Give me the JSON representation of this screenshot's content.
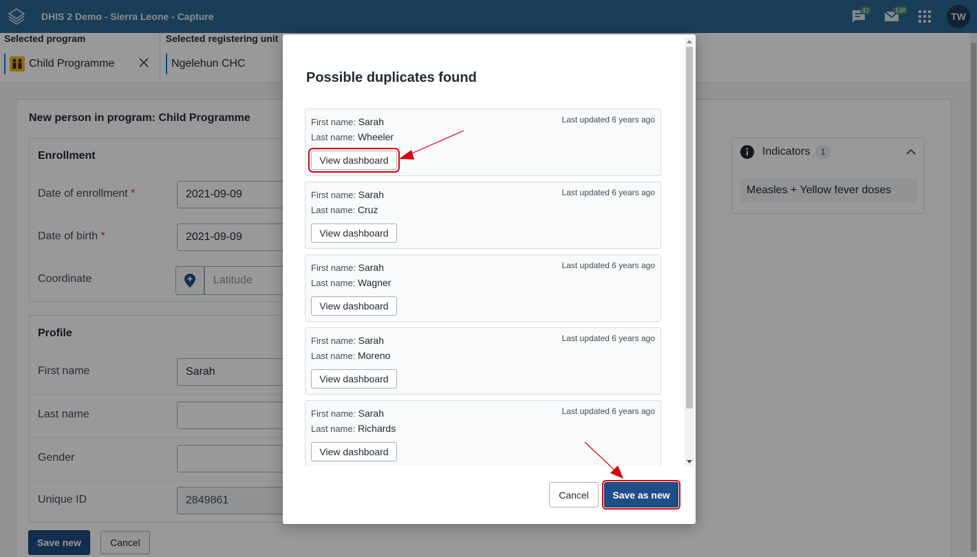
{
  "header": {
    "app_title": "DHIS 2 Demo - Sierra Leone - Capture",
    "messages_count": "42",
    "interpretations_count": "138",
    "user_initials": "TW"
  },
  "topbar": {
    "program_label": "Selected program",
    "program_value": "Child Programme",
    "org_unit_label": "Selected registering unit",
    "org_unit_value": "Ngelehun CHC"
  },
  "form": {
    "title": "New person in program: Child Programme",
    "enrollment": {
      "title": "Enrollment",
      "date_of_enrollment_label": "Date of enrollment",
      "date_of_enrollment_value": "2021-09-09",
      "date_of_birth_label": "Date of birth",
      "date_of_birth_value": "2021-09-09",
      "coordinate_label": "Coordinate",
      "latitude_placeholder": "Latitude",
      "required_marker": "*"
    },
    "profile": {
      "title": "Profile",
      "first_name_label": "First name",
      "first_name_value": "Sarah",
      "last_name_label": "Last name",
      "last_name_value": "",
      "gender_label": "Gender",
      "gender_value": "",
      "unique_id_label": "Unique ID",
      "unique_id_value": "2849861"
    },
    "save_new_label": "Save new",
    "cancel_label": "Cancel"
  },
  "indicators": {
    "title": "Indicators",
    "count": "1",
    "items": [
      "Measles + Yellow fever doses"
    ]
  },
  "modal": {
    "title": "Possible duplicates found",
    "first_name_label": "First name:",
    "last_name_label": "Last name:",
    "view_dashboard_label": "View dashboard",
    "duplicates": [
      {
        "first_name": "Sarah",
        "last_name": "Wheeler",
        "updated": "Last updated 6 years ago"
      },
      {
        "first_name": "Sarah",
        "last_name": "Cruz",
        "updated": "Last updated 6 years ago"
      },
      {
        "first_name": "Sarah",
        "last_name": "Wagner",
        "updated": "Last updated 6 years ago"
      },
      {
        "first_name": "Sarah",
        "last_name": "Moreno",
        "updated": "Last updated 6 years ago"
      },
      {
        "first_name": "Sarah",
        "last_name": "Richards",
        "updated": "Last updated 6 years ago"
      }
    ],
    "cancel_label": "Cancel",
    "save_as_new_label": "Save as new"
  },
  "colors": {
    "header_bg": "#2c6693",
    "primary_button": "#1f4e86",
    "annotation_red": "#d8000c"
  }
}
